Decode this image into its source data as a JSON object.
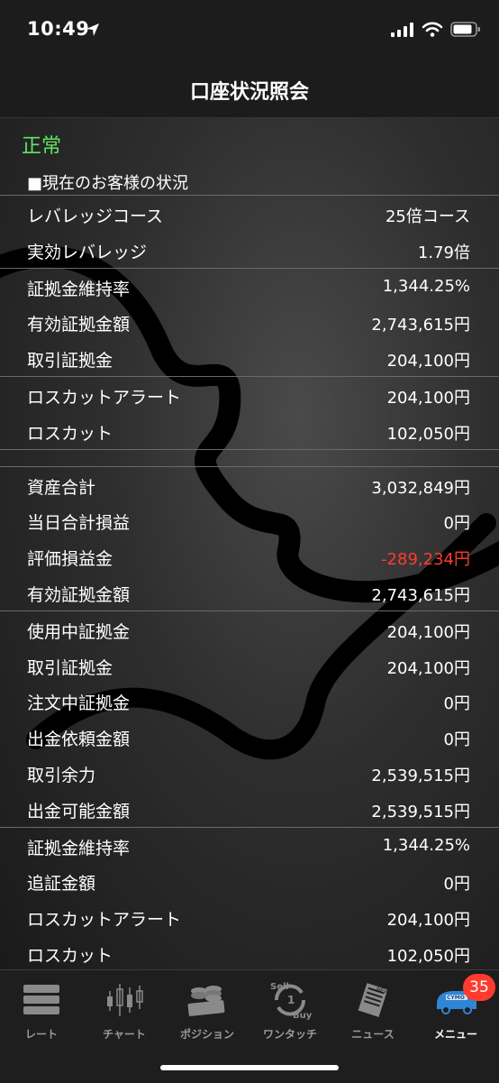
{
  "status_bar": {
    "time": "10:49"
  },
  "header": {
    "title": "口座状況照会"
  },
  "account_status": "正常",
  "section_title": "■現在のお客様の状況",
  "group1": [
    {
      "label": "レバレッジコース",
      "value": "25倍コース"
    },
    {
      "label": "実効レバレッジ",
      "value": "1.79倍"
    }
  ],
  "group2": [
    {
      "label": "証拠金維持率",
      "value": "1,344.25%"
    },
    {
      "label": "有効証拠金額",
      "value": "2,743,615円"
    },
    {
      "label": "取引証拠金",
      "value": "204,100円"
    }
  ],
  "group3": [
    {
      "label": "ロスカットアラート",
      "value": "204,100円"
    },
    {
      "label": "ロスカット",
      "value": "102,050円"
    }
  ],
  "group4": [
    {
      "label": "資産合計",
      "value": "3,032,849円"
    },
    {
      "label": "当日合計損益",
      "value": "0円"
    },
    {
      "label": "評価損益金",
      "value": "-289,234円"
    },
    {
      "label": "有効証拠金額",
      "value": "2,743,615円"
    }
  ],
  "group5": [
    {
      "label": "使用中証拠金",
      "value": "204,100円"
    },
    {
      "label": "取引証拠金",
      "value": "204,100円"
    },
    {
      "label": "注文中証拠金",
      "value": "0円"
    },
    {
      "label": "出金依頼金額",
      "value": "0円"
    },
    {
      "label": "取引余力",
      "value": "2,539,515円"
    },
    {
      "label": "出金可能金額",
      "value": "2,539,515円"
    }
  ],
  "group6": [
    {
      "label": "証拠金維持率",
      "value": "1,344.25%"
    },
    {
      "label": "追証金額",
      "value": "0円"
    },
    {
      "label": "ロスカットアラート",
      "value": "204,100円"
    },
    {
      "label": "ロスカット",
      "value": "102,050円"
    }
  ],
  "colors": {
    "normal_status": "#5fe65f",
    "negative": "#ff3b30",
    "badge": "#ff3b30"
  },
  "tabs": {
    "rate": "レート",
    "chart": "チャート",
    "position": "ポジション",
    "one_touch": "ワンタッチ",
    "news": "ニュース",
    "menu": "メニュー"
  },
  "tab_icons": {
    "sell_text": "Sell",
    "one_text": "1",
    "buy_text": "Buy",
    "news_text": "NEWS",
    "cymo_text": "CYMO"
  },
  "menu_badge": "35"
}
